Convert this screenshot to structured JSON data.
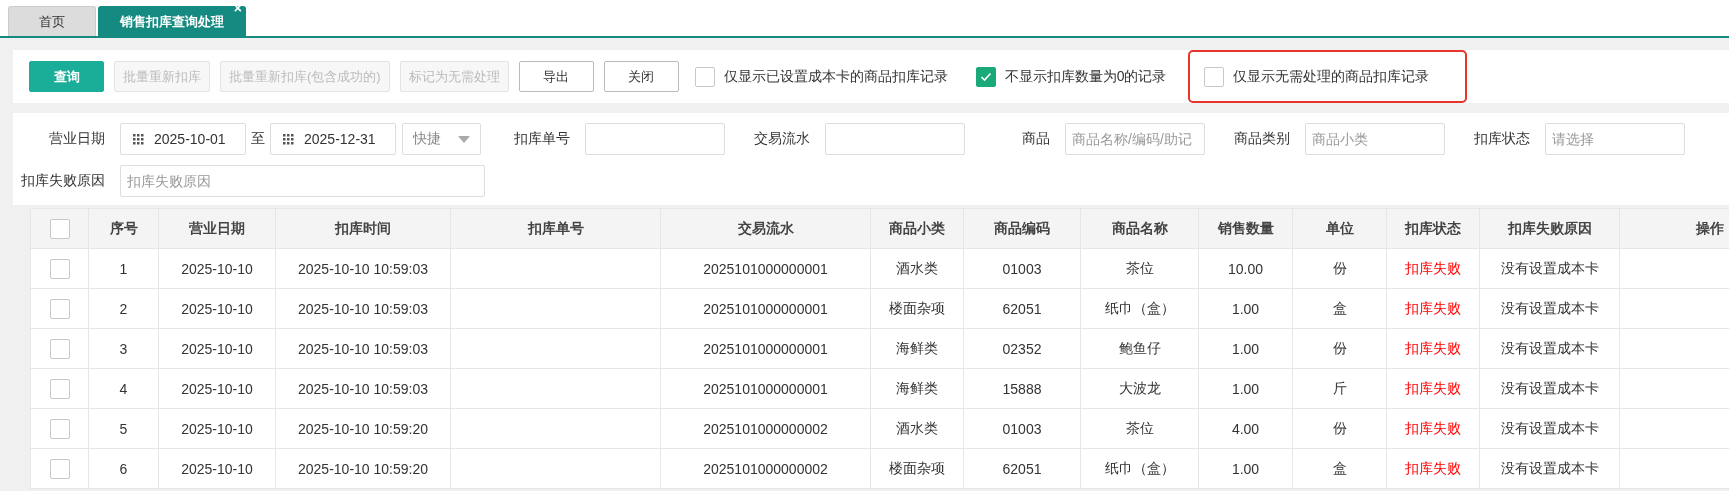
{
  "tabs": [
    {
      "label": "首页",
      "selected": false,
      "closable": false
    },
    {
      "label": "销售扣库查询处理",
      "selected": true,
      "closable": true,
      "close": "×"
    }
  ],
  "toolbar": {
    "buttons": [
      {
        "label": "查询",
        "kind": "primary",
        "disabled": false
      },
      {
        "label": "批量重新扣库",
        "kind": "default",
        "disabled": true
      },
      {
        "label": "批量重新扣库(包含成功的)",
        "kind": "default",
        "disabled": true
      },
      {
        "label": "标记为无需处理",
        "kind": "default",
        "disabled": true
      },
      {
        "label": "导出",
        "kind": "default",
        "disabled": false
      },
      {
        "label": "关闭",
        "kind": "default",
        "disabled": false
      }
    ],
    "options": [
      {
        "label": "仅显示已设置成本卡的商品扣库记录",
        "checked": false,
        "highlighted": false
      },
      {
        "label": "不显示扣库数量为0的记录",
        "checked": true,
        "highlighted": false
      },
      {
        "label": "仅显示无需处理的商品扣库记录",
        "checked": false,
        "highlighted": true
      }
    ]
  },
  "filters": {
    "rows": [
      [
        {
          "label": "营业日期",
          "kind": "date-range",
          "from": "2025-10-01",
          "to_label": "至",
          "to": "2025-12-31",
          "quick": "快捷"
        },
        {
          "label": "扣库单号",
          "kind": "text"
        },
        {
          "label": "交易流水",
          "kind": "text"
        },
        {
          "label": "商品",
          "kind": "text",
          "placeholder": "商品名称/编码/助记"
        },
        {
          "label": "商品类别",
          "kind": "text",
          "placeholder": "商品小类"
        },
        {
          "label": "扣库状态",
          "kind": "select",
          "placeholder": "请选择"
        }
      ],
      [
        {
          "label": "扣库失败原因",
          "kind": "wide-text",
          "placeholder": "扣库失败原因"
        }
      ]
    ]
  },
  "table": {
    "header_checked": false,
    "columns": [
      {
        "label": "序号",
        "kind": "text"
      },
      {
        "label": "营业日期",
        "kind": "text"
      },
      {
        "label": "扣库时间",
        "kind": "text"
      },
      {
        "label": "扣库单号",
        "kind": "text"
      },
      {
        "label": "交易流水",
        "kind": "text"
      },
      {
        "label": "商品小类",
        "kind": "text"
      },
      {
        "label": "商品编码",
        "kind": "text"
      },
      {
        "label": "商品名称",
        "kind": "text"
      },
      {
        "label": "销售数量",
        "kind": "text"
      },
      {
        "label": "单位",
        "kind": "text"
      },
      {
        "label": "扣库状态",
        "kind": "status"
      },
      {
        "label": "扣库失败原因",
        "kind": "text"
      },
      {
        "label": "操作",
        "kind": "text"
      }
    ],
    "rows": [
      {
        "checked": false,
        "cells": [
          "1",
          "2025-10-10",
          "2025-10-10 10:59:03",
          "",
          "2025101000000001",
          "酒水类",
          "01003",
          "茶位",
          "10.00",
          "份",
          "扣库失败",
          "没有设置成本卡",
          ""
        ]
      },
      {
        "checked": false,
        "cells": [
          "2",
          "2025-10-10",
          "2025-10-10 10:59:03",
          "",
          "2025101000000001",
          "楼面杂项",
          "62051",
          "纸巾（盒）",
          "1.00",
          "盒",
          "扣库失败",
          "没有设置成本卡",
          ""
        ]
      },
      {
        "checked": false,
        "cells": [
          "3",
          "2025-10-10",
          "2025-10-10 10:59:03",
          "",
          "2025101000000001",
          "海鲜类",
          "02352",
          "鲍鱼仔",
          "1.00",
          "份",
          "扣库失败",
          "没有设置成本卡",
          ""
        ]
      },
      {
        "checked": false,
        "cells": [
          "4",
          "2025-10-10",
          "2025-10-10 10:59:03",
          "",
          "2025101000000001",
          "海鲜类",
          "15888",
          "大波龙",
          "1.00",
          "斤",
          "扣库失败",
          "没有设置成本卡",
          ""
        ]
      },
      {
        "checked": false,
        "cells": [
          "5",
          "2025-10-10",
          "2025-10-10 10:59:20",
          "",
          "2025101000000002",
          "酒水类",
          "01003",
          "茶位",
          "4.00",
          "份",
          "扣库失败",
          "没有设置成本卡",
          ""
        ]
      },
      {
        "checked": false,
        "cells": [
          "6",
          "2025-10-10",
          "2025-10-10 10:59:20",
          "",
          "2025101000000002",
          "楼面杂项",
          "62051",
          "纸巾（盒）",
          "1.00",
          "盒",
          "扣库失败",
          "没有设置成本卡",
          ""
        ]
      }
    ]
  }
}
